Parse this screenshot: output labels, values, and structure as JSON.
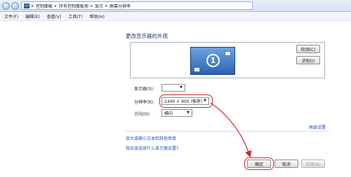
{
  "addressbar": {
    "crumbs": [
      "控制面板",
      "所有控制面板项",
      "显示",
      "屏幕分辨率"
    ]
  },
  "menubar": {
    "items": [
      "文件(F)",
      "编辑(E)",
      "查看(V)",
      "工具(T)",
      "帮助(H)"
    ]
  },
  "main": {
    "title": "更改显示器的外观",
    "monitor_number": "1",
    "detect_label": "检测(C)",
    "identify_label": "识别(I)",
    "display_label": "显示器(S):",
    "display_value": "",
    "resolution_label": "分辨率(R):",
    "resolution_value": "1440 × 900 (推荐)",
    "orientation_label": "方向(O):",
    "orientation_value": "横向",
    "advanced_link": "高级设置",
    "text_size_link": "放大或缩小文本和其他项目",
    "help_link": "我应该选择什么显示器设置?"
  },
  "footer": {
    "ok_label": "确定",
    "cancel_label": "取消",
    "apply_label": "应用(A)"
  },
  "colors": {
    "annotation": "#d4282d",
    "link": "#1c55b3",
    "title": "#1b3a78"
  }
}
